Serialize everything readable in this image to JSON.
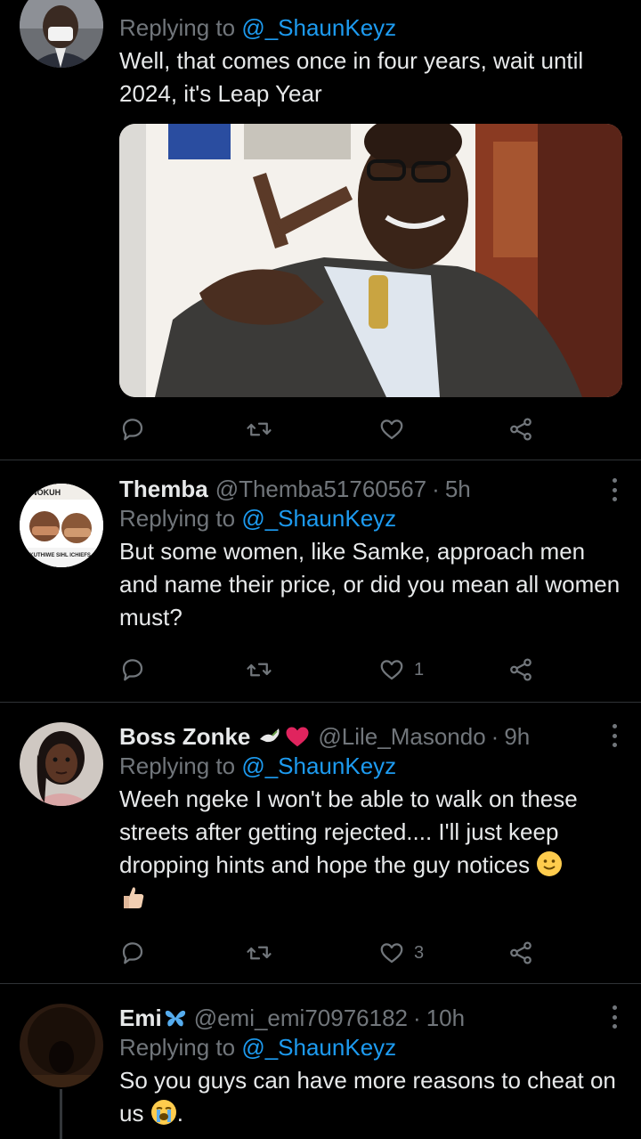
{
  "tweets": [
    {
      "reply_prefix": "Replying to",
      "reply_handle": "@_ShaunKeyz",
      "text": "Well, that comes once in four years, wait until 2024, it's Leap Year",
      "likes": ""
    },
    {
      "name": "Themba",
      "handle": "@Themba51760567",
      "dot": "·",
      "time": "5h",
      "reply_prefix": "Replying to",
      "reply_handle": "@_ShaunKeyz",
      "text": "But some women, like Samke, approach men and name their price, or did you mean all women must?",
      "likes": "1",
      "avatar_text_top": "IA NOKUH",
      "avatar_text_bottom": "ZE KUTHIWE SIHL ICHIEFS"
    },
    {
      "name": "Boss Zonke",
      "handle": "@Lile_Masondo",
      "dot": "·",
      "time": "9h",
      "reply_prefix": "Replying to",
      "reply_handle": "@_ShaunKeyz",
      "text": "Weeh ngeke I won't be able to walk on these streets after getting rejected.... I'll just keep dropping hints and hope the guy notices",
      "likes": "3"
    },
    {
      "name": "Emi",
      "handle": "@emi_emi70976182",
      "dot": "·",
      "time": "10h",
      "reply_prefix": "Replying to",
      "reply_handle": "@_ShaunKeyz",
      "text": "So you guys can have more reasons to cheat on us",
      "text_tail": "."
    }
  ],
  "icons": {
    "reply": "reply-icon",
    "retweet": "retweet-icon",
    "like": "heart-icon",
    "share": "share-icon",
    "more": "more-icon"
  },
  "colors": {
    "background": "#000000",
    "text": "#e7e9ea",
    "muted": "#71767b",
    "link": "#1d9bf0",
    "divider": "#2f3336"
  }
}
